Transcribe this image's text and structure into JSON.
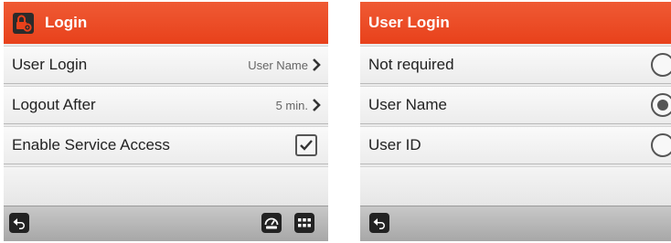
{
  "left_panel": {
    "title": "Login",
    "title_icon": "lock-gear-icon",
    "rows": [
      {
        "label": "User Login",
        "value": "User Name",
        "control": "chevron"
      },
      {
        "label": "Logout After",
        "value": "5 min.",
        "control": "chevron"
      },
      {
        "label": "Enable Service Access",
        "control": "checkbox",
        "checked": true
      }
    ],
    "footer_icons": [
      "back-arrow-icon",
      "gauge-icon",
      "grid-menu-icon"
    ]
  },
  "right_panel": {
    "title": "User Login",
    "options": [
      {
        "label": "Not required",
        "selected": false
      },
      {
        "label": "User Name",
        "selected": true
      },
      {
        "label": "User ID",
        "selected": false
      }
    ],
    "footer_icons": [
      "back-arrow-icon"
    ]
  },
  "colors": {
    "header": "#e8411b",
    "row_bg": "#f3f3f3",
    "footer": "#b5b5b5",
    "icon_dark": "#222222"
  }
}
